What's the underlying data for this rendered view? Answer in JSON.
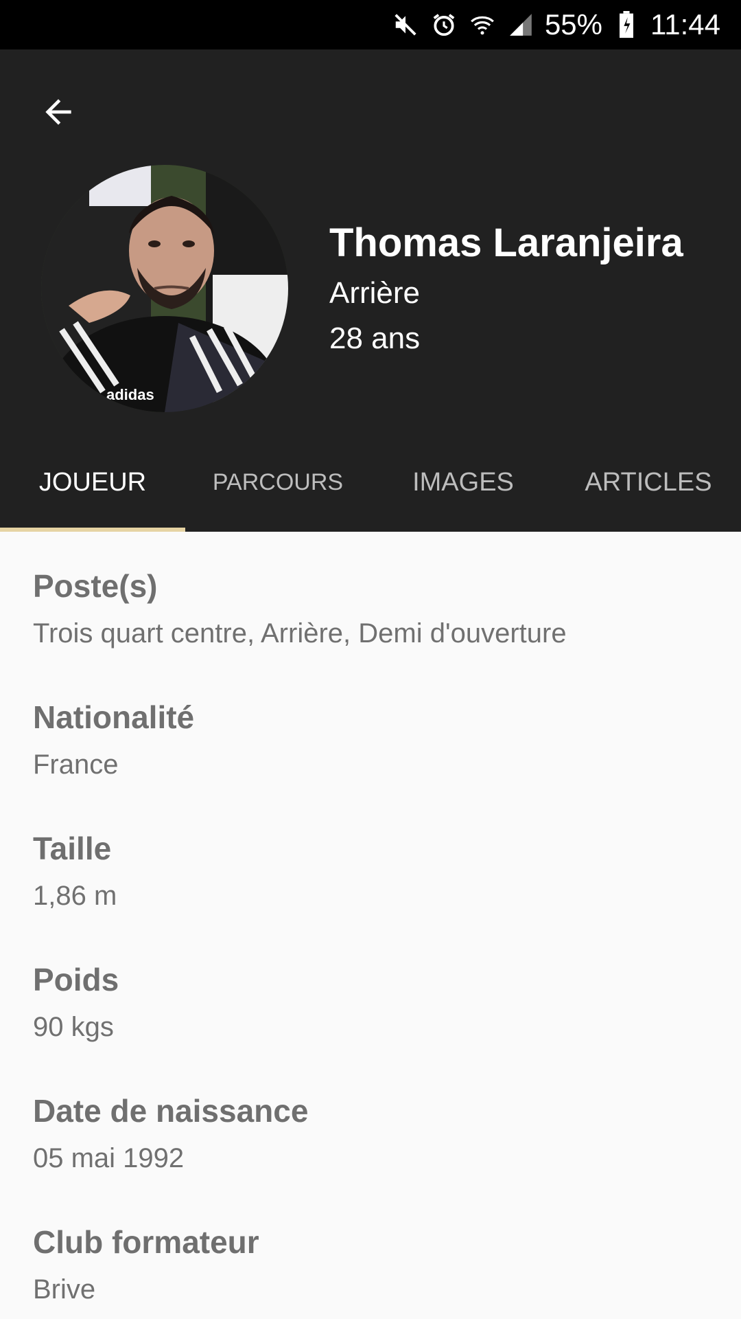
{
  "status_bar": {
    "battery": "55%",
    "time": "11:44",
    "icons": [
      "mute-icon",
      "alarm-icon",
      "wifi-icon",
      "signal-icon",
      "battery-icon"
    ]
  },
  "header": {
    "name": "Thomas Laranjeira",
    "position": "Arrière",
    "age": "28 ans"
  },
  "tabs": [
    {
      "label": "JOUEUR",
      "active": true
    },
    {
      "label": "PARCOURS",
      "active": false
    },
    {
      "label": "IMAGES",
      "active": false
    },
    {
      "label": "ARTICLES",
      "active": false
    }
  ],
  "fields": [
    {
      "label": "Poste(s)",
      "value": "Trois quart centre, Arrière, Demi d'ouverture"
    },
    {
      "label": "Nationalité",
      "value": "France"
    },
    {
      "label": "Taille",
      "value": "1,86 m"
    },
    {
      "label": "Poids",
      "value": "90 kgs"
    },
    {
      "label": "Date de naissance",
      "value": "05 mai 1992"
    },
    {
      "label": "Club formateur",
      "value": "Brive"
    }
  ],
  "colors": {
    "header_bg": "#212121",
    "tab_indicator": "#e6d3a3",
    "content_bg": "#fafafa"
  }
}
